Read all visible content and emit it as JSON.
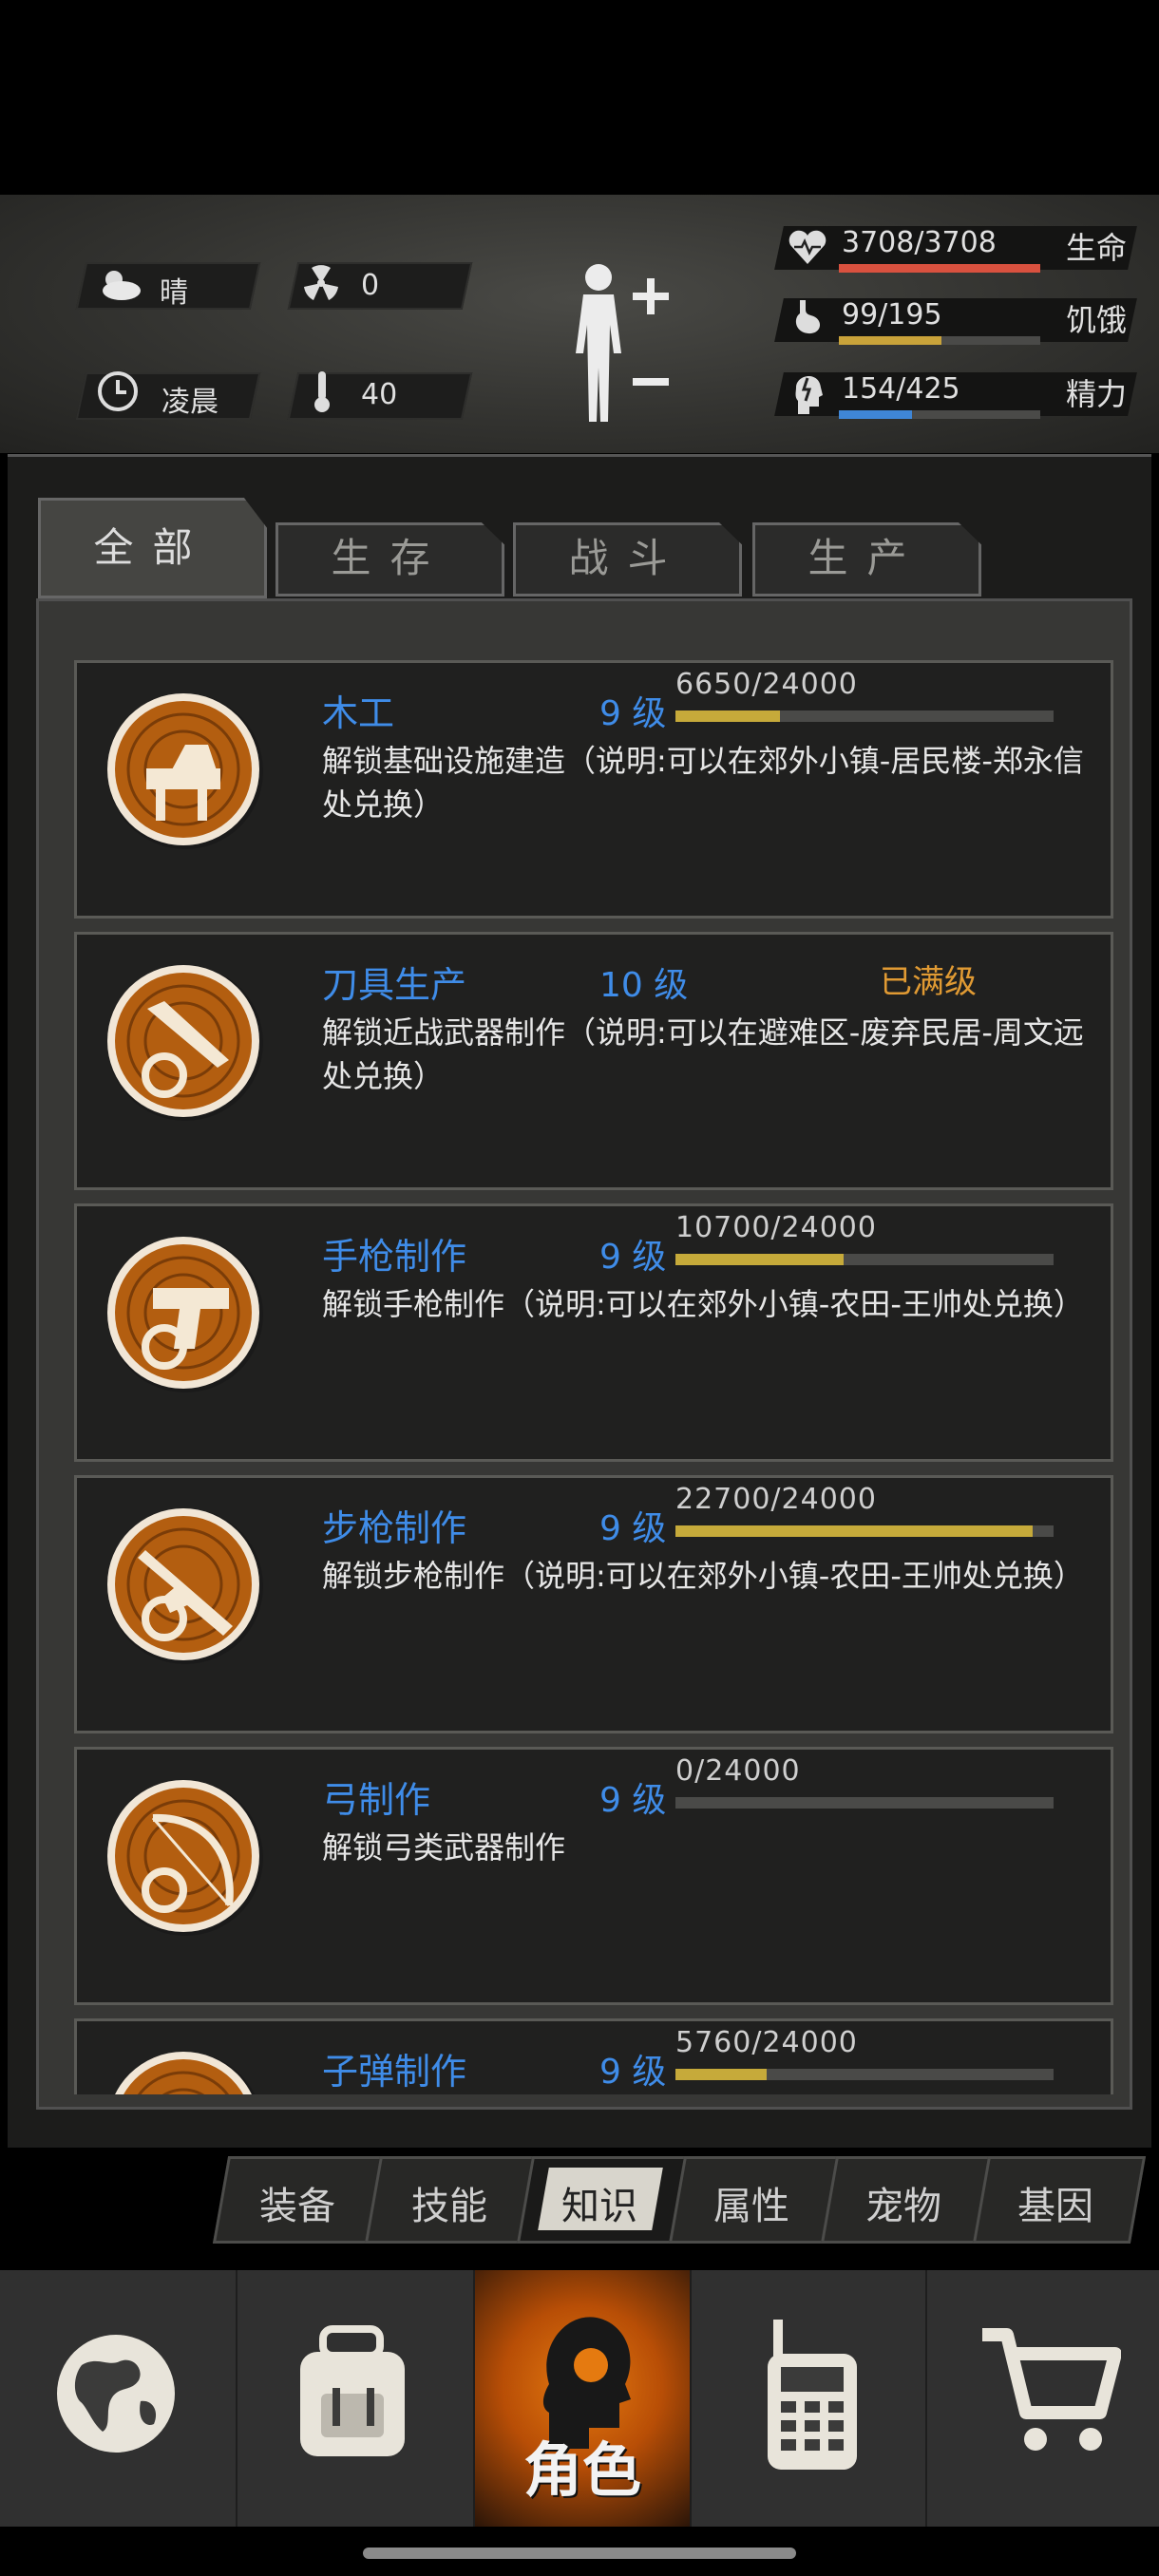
{
  "status": {
    "weather": "晴",
    "radiation": "0",
    "time_of_day": "凌晨",
    "temperature": "40",
    "health": {
      "value": "3708/3708",
      "label": "生命",
      "current": 3708,
      "max": 3708,
      "color": "#d9513f"
    },
    "hunger": {
      "value": "99/195",
      "label": "饥饿",
      "current": 99,
      "max": 195,
      "color": "#c9a33a"
    },
    "energy": {
      "value": "154/425",
      "label": "精力",
      "current": 154,
      "max": 425,
      "color": "#3f86d6"
    }
  },
  "tabs": [
    {
      "label": "全部",
      "active": true
    },
    {
      "label": "生存",
      "active": false
    },
    {
      "label": "战斗",
      "active": false
    },
    {
      "label": "生产",
      "active": false
    }
  ],
  "skills": [
    {
      "name": "木工",
      "level": "9 级",
      "progress_text": "6650/24000",
      "current": 6650,
      "max": 24000,
      "maxed_text": "",
      "desc": "解锁基础设施建造（说明:可以在郊外小镇-居民楼-郑永信处兑换）",
      "icon": "carpentry-icon"
    },
    {
      "name": "刀具生产",
      "level": "10 级",
      "progress_text": "",
      "current": 0,
      "max": 0,
      "maxed_text": "已满级",
      "desc": "解锁近战武器制作（说明:可以在避难区-废弃民居-周文远处兑换）",
      "icon": "knife-icon"
    },
    {
      "name": "手枪制作",
      "level": "9 级",
      "progress_text": "10700/24000",
      "current": 10700,
      "max": 24000,
      "maxed_text": "",
      "desc": "解锁手枪制作（说明:可以在郊外小镇-农田-王帅处兑换）",
      "icon": "pistol-icon"
    },
    {
      "name": "步枪制作",
      "level": "9 级",
      "progress_text": "22700/24000",
      "current": 22700,
      "max": 24000,
      "maxed_text": "",
      "desc": "解锁步枪制作（说明:可以在郊外小镇-农田-王帅处兑换）",
      "icon": "rifle-icon"
    },
    {
      "name": "弓制作",
      "level": "9 级",
      "progress_text": "0/24000",
      "current": 0,
      "max": 24000,
      "maxed_text": "",
      "desc": "解锁弓类武器制作",
      "icon": "bow-icon"
    },
    {
      "name": "子弹制作",
      "level": "9 级",
      "progress_text": "5760/24000",
      "current": 5760,
      "max": 24000,
      "maxed_text": "",
      "desc": "",
      "icon": "bullet-icon"
    }
  ],
  "subtabs": [
    {
      "label": "装备",
      "active": false
    },
    {
      "label": "技能",
      "active": false
    },
    {
      "label": "知识",
      "active": true
    },
    {
      "label": "属性",
      "active": false
    },
    {
      "label": "宠物",
      "active": false
    },
    {
      "label": "基因",
      "active": false
    }
  ],
  "bottom_nav": [
    {
      "label": "",
      "icon": "globe-icon"
    },
    {
      "label": "",
      "icon": "backpack-icon"
    },
    {
      "label": "角色",
      "icon": "character-icon",
      "active": true
    },
    {
      "label": "",
      "icon": "radio-icon"
    },
    {
      "label": "",
      "icon": "cart-icon"
    }
  ]
}
